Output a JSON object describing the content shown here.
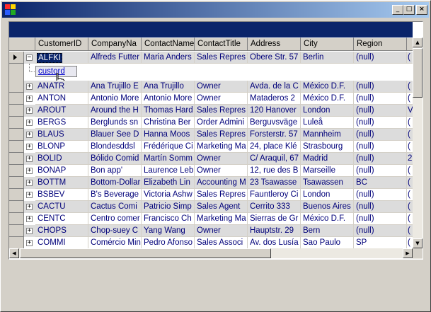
{
  "window": {
    "title": ""
  },
  "grid": {
    "columns": [
      "CustomerID",
      "CompanyNa",
      "ContactName",
      "ContactTitle",
      "Address",
      "City",
      "Region"
    ],
    "expanded_row": {
      "id": "ALFKI",
      "company": "Alfreds Futter",
      "contact": "Maria Anders",
      "title": "Sales Repres",
      "address": "Obere Str. 57",
      "city": "Berlin",
      "region": "(null)"
    },
    "relation_link": "custord",
    "rows": [
      [
        "ANATR",
        "Ana Trujillo E",
        "Ana Trujillo",
        "Owner",
        "Avda. de la C",
        "México D.F.",
        "(null)"
      ],
      [
        "ANTON",
        "Antonio More",
        "Antonio More",
        "Owner",
        "Mataderos  2",
        "México D.F.",
        "(null)"
      ],
      [
        "AROUT",
        "Around the H",
        "Thomas Hard",
        "Sales Repres",
        "120 Hanover",
        "London",
        "(null)"
      ],
      [
        "BERGS",
        "Berglunds sn",
        "Christina Ber",
        "Order Admini",
        "Berguvsväge",
        "Luleå",
        "(null)"
      ],
      [
        "BLAUS",
        "Blauer See D",
        "Hanna Moos",
        "Sales Repres",
        "Forsterstr. 57",
        "Mannheim",
        "(null)"
      ],
      [
        "BLONP",
        "Blondesddsl",
        "Frédérique Ci",
        "Marketing Ma",
        "24, place Klé",
        "Strasbourg",
        "(null)"
      ],
      [
        "BOLID",
        "Bólido Comid",
        "Martín Somm",
        "Owner",
        "C/ Araquil, 67",
        "Madrid",
        "(null)"
      ],
      [
        "BONAP",
        "Bon app'",
        "Laurence Leb",
        "Owner",
        "12, rue des B",
        "Marseille",
        "(null)"
      ],
      [
        "BOTTM",
        "Bottom-Dollar",
        "Elizabeth Lin",
        "Accounting M",
        "23 Tsawasse",
        "Tsawassen",
        "BC"
      ],
      [
        "BSBEV",
        "B's Beverage",
        "Victoria Ashw",
        "Sales Repres",
        "Fauntleroy Ci",
        "London",
        "(null)"
      ],
      [
        "CACTU",
        "Cactus Comi",
        "Patricio Simp",
        "Sales Agent",
        "Cerrito 333",
        "Buenos Aires",
        "(null)"
      ],
      [
        "CENTC",
        "Centro comer",
        "Francisco Ch",
        "Marketing Ma",
        "Sierras de Gr",
        "México D.F.",
        "(null)"
      ],
      [
        "CHOPS",
        "Chop-suey C",
        "Yang Wang",
        "Owner",
        "Hauptstr. 29",
        "Bern",
        "(null)"
      ],
      [
        "COMMI",
        "Comércio Min",
        "Pedro Afonso",
        "Sales Associ",
        "Av. dos Lusía",
        "Sao Paulo",
        "SP"
      ]
    ],
    "overflow_col": [
      "(",
      "(",
      "(",
      "V",
      "(",
      "(",
      "(",
      "2",
      "(",
      "(",
      "(",
      "(",
      "(",
      "(",
      "(",
      "("
    ]
  }
}
